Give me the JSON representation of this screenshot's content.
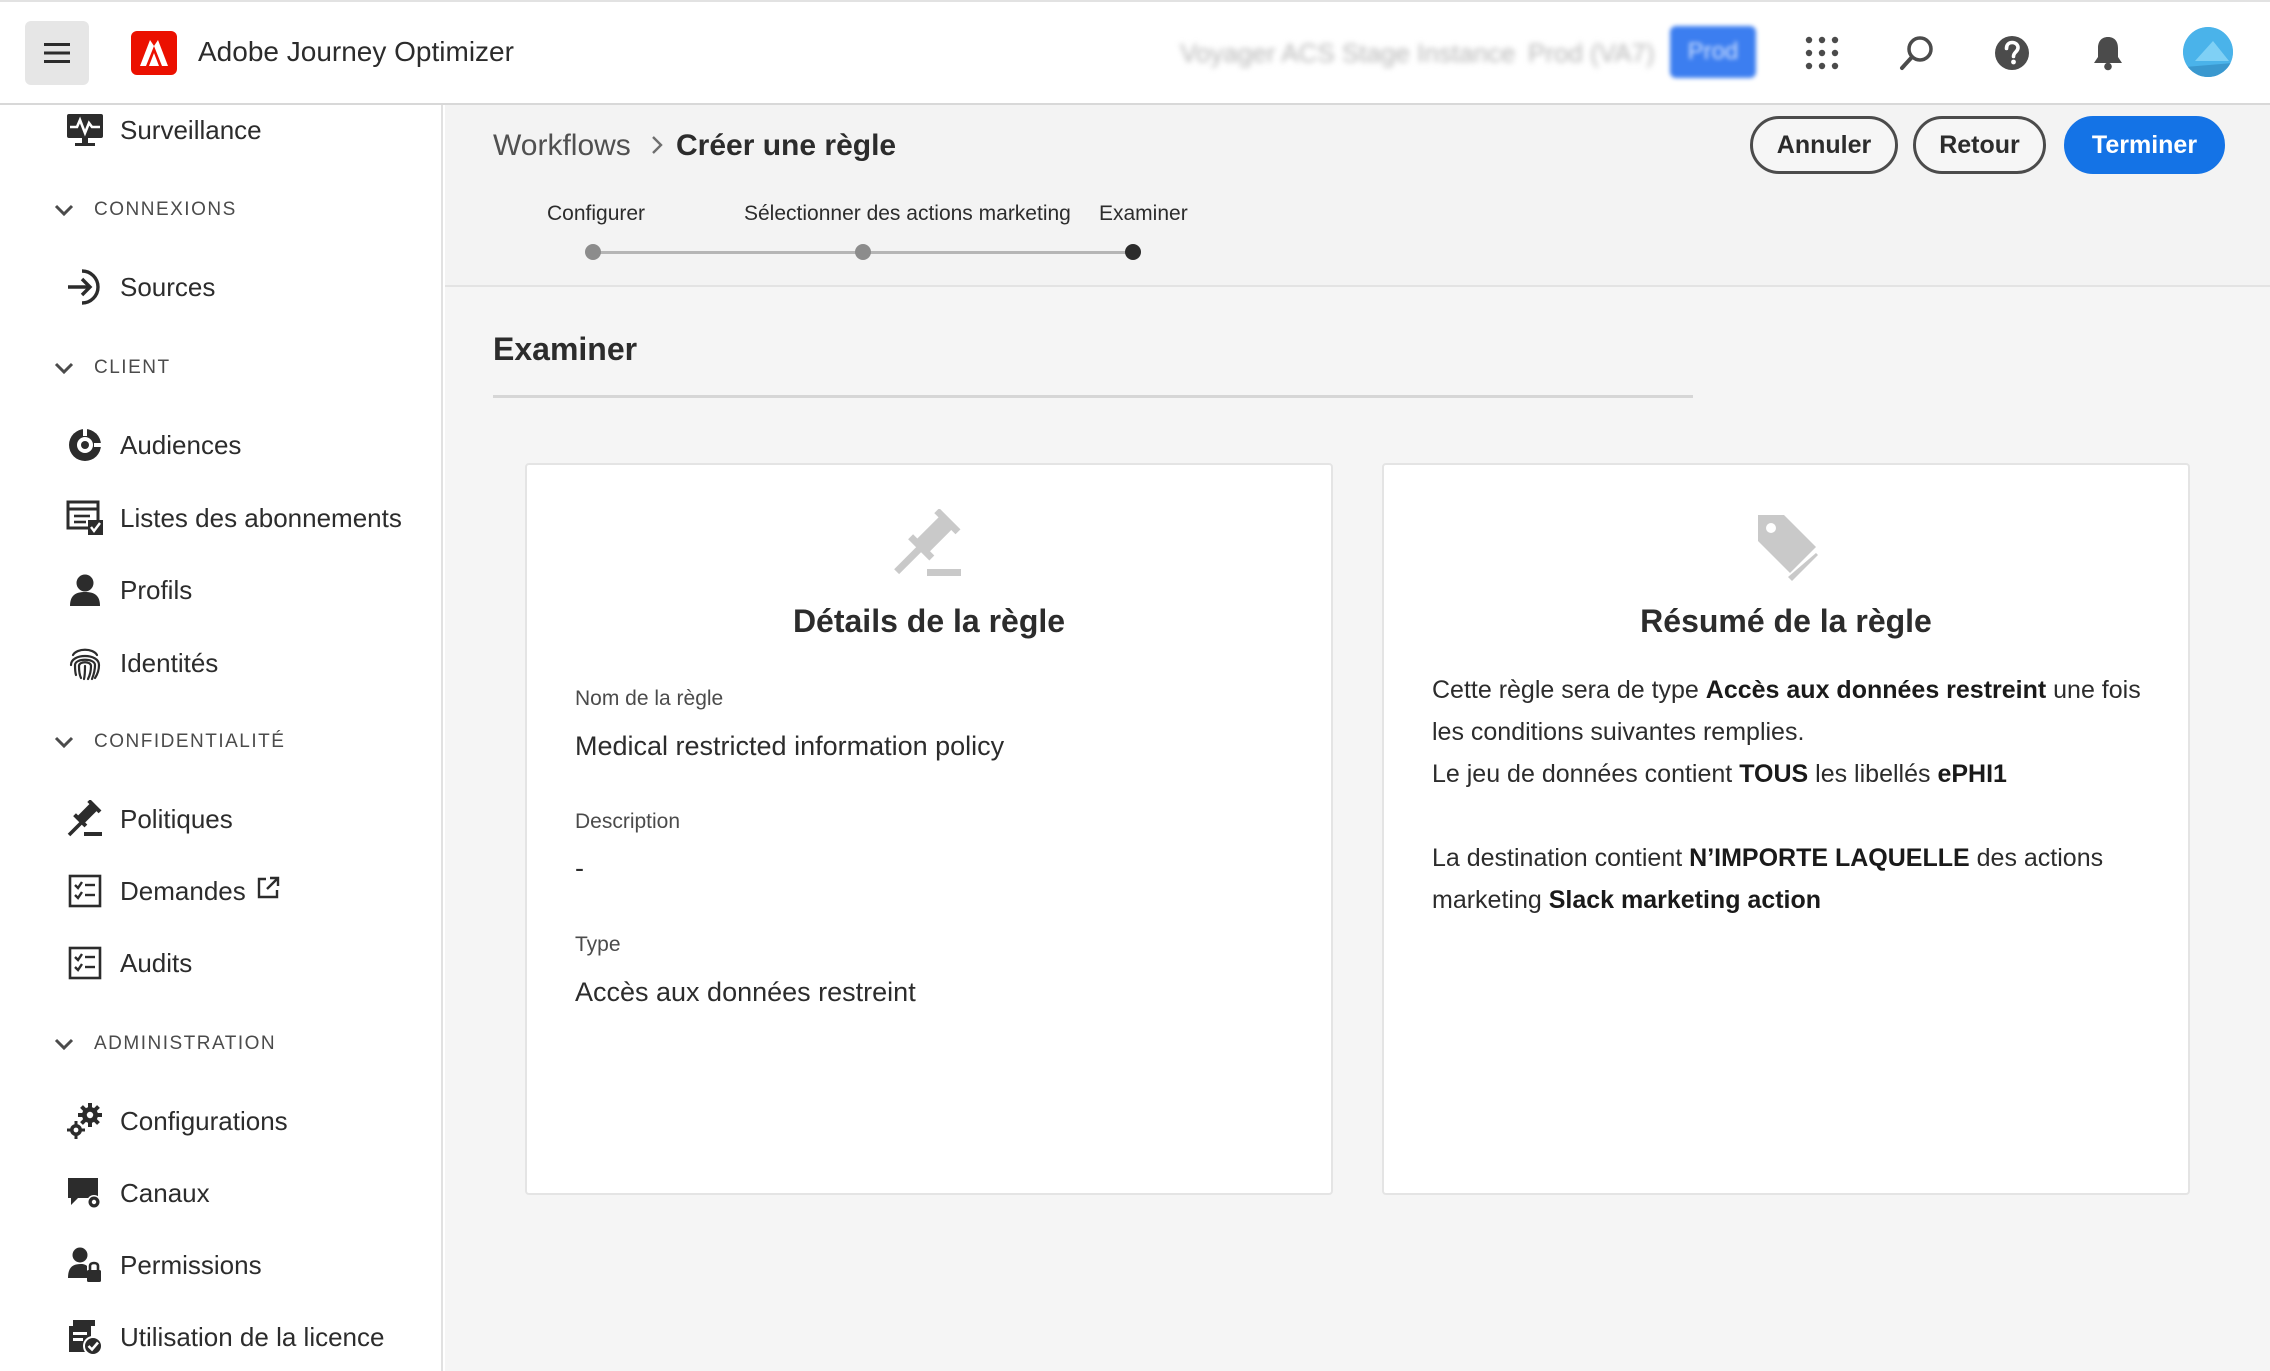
{
  "app": {
    "title": "Adobe Journey Optimizer",
    "sandbox_name": "Voyager ACS Stage Instance",
    "sandbox_env": "Prod (VA7)",
    "env_badge": "Prod"
  },
  "sidebar": {
    "items": [
      {
        "label": "Surveillance",
        "icon": "monitoring-icon"
      },
      {
        "label": "Sources",
        "icon": "sources-icon"
      },
      {
        "label": "Audiences",
        "icon": "audiences-icon"
      },
      {
        "label": "Listes des abonnements",
        "icon": "subscription-lists-icon"
      },
      {
        "label": "Profils",
        "icon": "profile-icon"
      },
      {
        "label": "Identités",
        "icon": "fingerprint-icon"
      },
      {
        "label": "Politiques",
        "icon": "gavel-icon"
      },
      {
        "label": "Demandes",
        "icon": "checklist-icon"
      },
      {
        "label": "Audits",
        "icon": "checklist-icon"
      },
      {
        "label": "Configurations",
        "icon": "gears-icon"
      },
      {
        "label": "Canaux",
        "icon": "channels-icon"
      },
      {
        "label": "Permissions",
        "icon": "user-lock-icon"
      },
      {
        "label": "Utilisation de la licence",
        "icon": "license-usage-icon"
      }
    ],
    "sections": {
      "connexions": "CONNEXIONS",
      "client": "CLIENT",
      "confidentialite": "CONFIDENTIALITÉ",
      "administration": "ADMINISTRATION"
    }
  },
  "breadcrumb": {
    "root": "Workflows",
    "current": "Créer une règle"
  },
  "actions": {
    "cancel": "Annuler",
    "back": "Retour",
    "finish": "Terminer"
  },
  "steps": [
    {
      "label": "Configurer",
      "state": "done"
    },
    {
      "label": "Sélectionner des actions marketing",
      "state": "done"
    },
    {
      "label": "Examiner",
      "state": "current"
    }
  ],
  "review": {
    "title": "Examiner",
    "details_card": {
      "title": "Détails de la règle",
      "name_label": "Nom de la règle",
      "name_value": "Medical restricted information policy",
      "description_label": "Description",
      "description_value": "-",
      "type_label": "Type",
      "type_value": "Accès aux données restreint"
    },
    "summary_card": {
      "title": "Résumé de la règle",
      "p1_a": "Cette règle sera de type ",
      "p1_b": "Accès aux données restreint",
      "p1_c": " une fois les conditions suivantes remplies.",
      "p2_a": "Le jeu de données contient ",
      "p2_b": "TOUS",
      "p2_c": " les libellés ",
      "p2_d": "ePHI1",
      "p3_a": "La destination contient ",
      "p3_b": "N’IMPORTE LAQUELLE",
      "p3_c": " des actions marketing ",
      "p3_d": "Slack marketing action"
    }
  },
  "colors": {
    "accent": "#1473e6",
    "brand": "#eb1000"
  }
}
